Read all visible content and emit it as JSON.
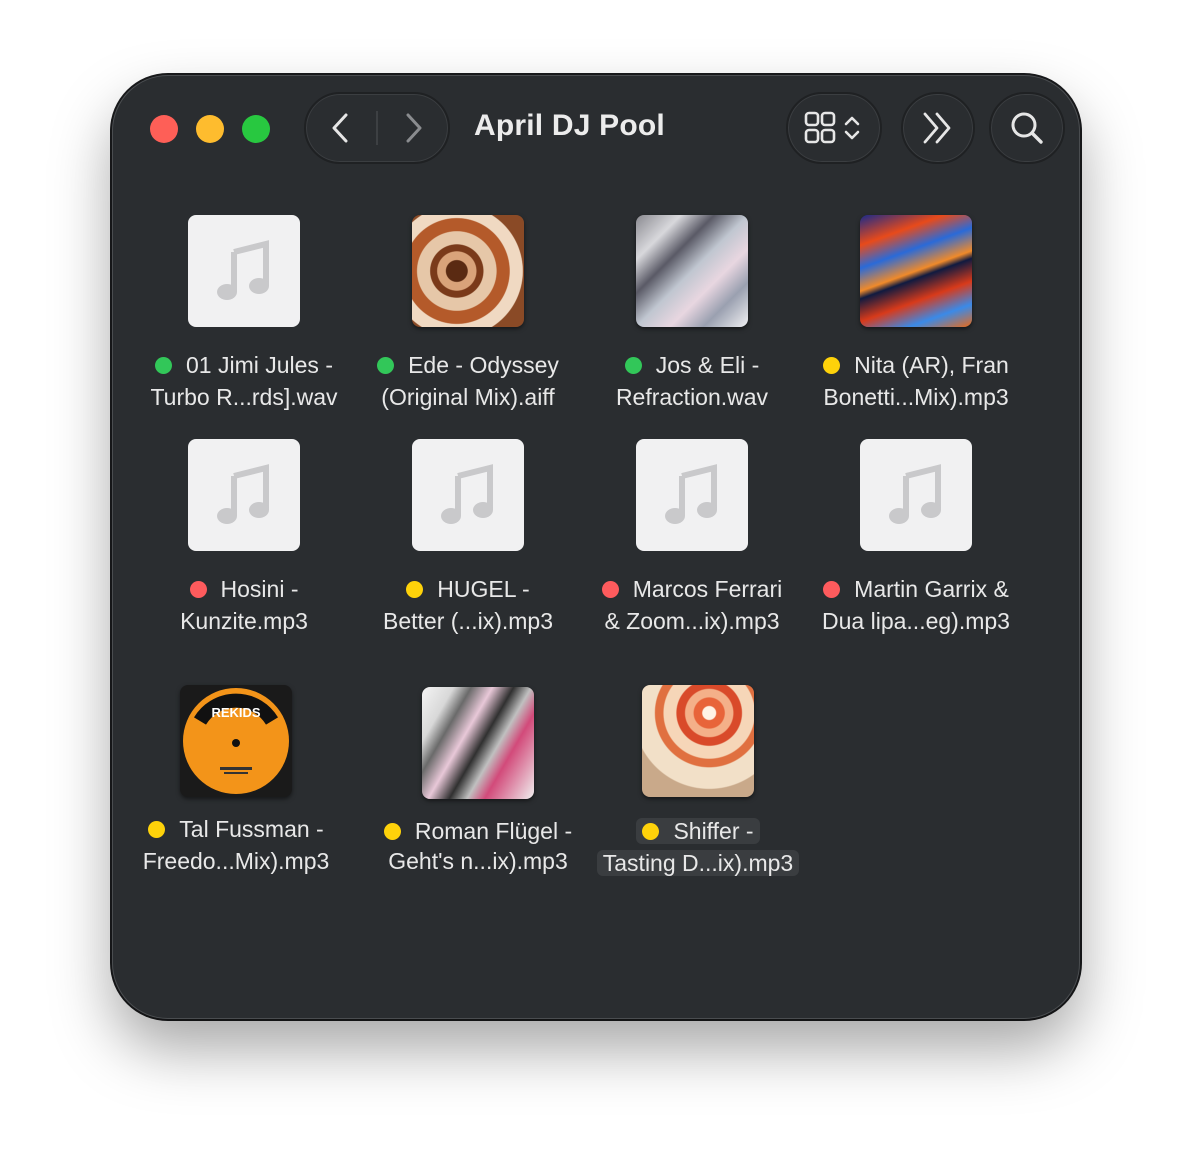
{
  "window": {
    "title": "April DJ Pool"
  },
  "toolbar": {
    "back_icon": "chevron-left-icon",
    "forward_icon": "chevron-right-icon",
    "view_icon": "grid-view-icon",
    "more_icon": "double-chevron-right-icon",
    "search_icon": "search-icon"
  },
  "colors": {
    "green": "#32c759",
    "yellow": "#fed20a",
    "red": "#fe5b5d"
  },
  "files": [
    {
      "line1": "01 Jimi Jules -",
      "line2": "Turbo R...rds].wav",
      "tag": "green",
      "thumb": "generic-audio-icon"
    },
    {
      "line1": "Ede - Odyssey",
      "line2": "(Original Mix).aiff",
      "tag": "green",
      "thumb": "album-art"
    },
    {
      "line1": "Jos & Eli -",
      "line2": "Refraction.wav",
      "tag": "green",
      "thumb": "album-art"
    },
    {
      "line1": "Nita (AR), Fran",
      "line2": "Bonetti...Mix).mp3",
      "tag": "yellow",
      "thumb": "album-art"
    },
    {
      "line1": "Hosini -",
      "line2": "Kunzite.mp3",
      "tag": "red",
      "thumb": "generic-audio-icon"
    },
    {
      "line1": "HUGEL -",
      "line2": "Better (...ix).mp3",
      "tag": "yellow",
      "thumb": "generic-audio-icon"
    },
    {
      "line1": "Marcos Ferrari",
      "line2": "& Zoom...ix).mp3",
      "tag": "red",
      "thumb": "generic-audio-icon"
    },
    {
      "line1": "Martin Garrix &",
      "line2": "Dua lipa...eg).mp3",
      "tag": "red",
      "thumb": "generic-audio-icon"
    },
    {
      "line1": "Tal Fussman -",
      "line2": "Freedo...Mix).mp3",
      "tag": "yellow",
      "thumb": "album-art"
    },
    {
      "line1": "Roman Flügel -",
      "line2": "Geht's n...ix).mp3",
      "tag": "yellow",
      "thumb": "album-art"
    },
    {
      "line1": "Shiffer -",
      "line2": "Tasting D...ix).mp3",
      "tag": "yellow",
      "thumb": "album-art"
    }
  ],
  "vinyl_label": "REKIDS"
}
